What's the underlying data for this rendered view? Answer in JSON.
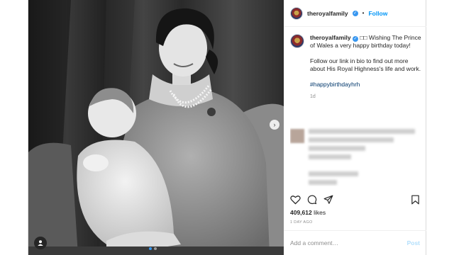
{
  "post": {
    "username": "theroyalfamily",
    "verified_mark": "✓",
    "separator": "•",
    "follow_label": "Follow",
    "caption_emoji": "□□",
    "caption_line1": "Wishing The Prince of Wales a very happy birthday today!",
    "caption_line2": "Follow our link in bio to find out more about His Royal Highness's life and work.",
    "hashtag": "#happybirthdayhrh",
    "caption_time": "1d",
    "likes_count": "409,612",
    "likes_label": "likes",
    "time_ago": "1 DAY AGO",
    "comment_placeholder": "Add a comment…",
    "post_label": "Post"
  },
  "media": {
    "next_arrow": "›",
    "carousel_count": 2,
    "carousel_active": 1
  },
  "icons": {
    "like": "heart-icon",
    "comment": "comment-icon",
    "share": "share-icon",
    "save": "bookmark-icon",
    "tag": "user-tag-icon",
    "verified": "verified-badge-icon"
  },
  "colors": {
    "accent": "#0095f6",
    "verified": "#3897f0",
    "hashtag": "#00376b",
    "muted": "#8e8e8e"
  }
}
